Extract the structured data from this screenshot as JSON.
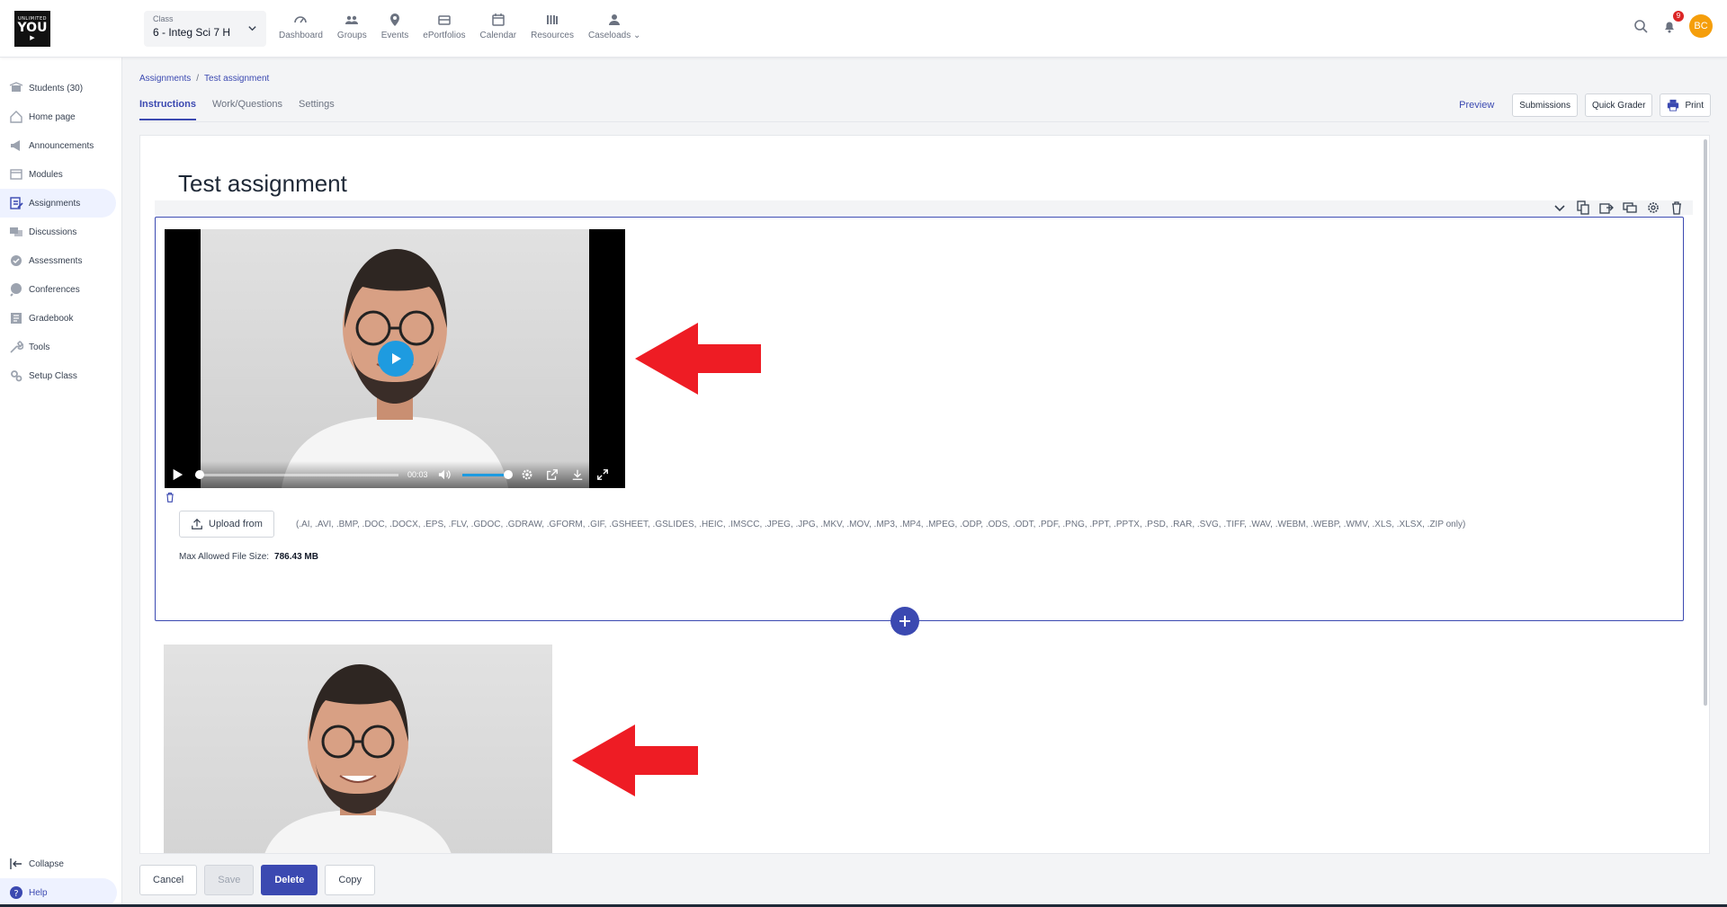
{
  "app": {
    "logo_text": [
      "UNLIMITED",
      "YOU",
      "▶"
    ]
  },
  "topbar": {
    "class_label": "Class",
    "class_value": "6 - Integ Sci 7 H",
    "nav": [
      {
        "label": "Dashboard",
        "icon": "gauge-icon"
      },
      {
        "label": "Groups",
        "icon": "users-icon"
      },
      {
        "label": "Events",
        "icon": "map-pin-icon"
      },
      {
        "label": "ePortfolios",
        "icon": "portfolio-icon"
      },
      {
        "label": "Calendar",
        "icon": "calendar-icon"
      },
      {
        "label": "Resources",
        "icon": "library-icon"
      },
      {
        "label": "Caseloads",
        "icon": "person-icon"
      }
    ],
    "notifications_count": "9",
    "avatar_initials": "BC"
  },
  "sidebar": {
    "items": [
      {
        "label": "Students (30)"
      },
      {
        "label": "Home page"
      },
      {
        "label": "Announcements"
      },
      {
        "label": "Modules"
      },
      {
        "label": "Assignments"
      },
      {
        "label": "Discussions"
      },
      {
        "label": "Assessments"
      },
      {
        "label": "Conferences"
      },
      {
        "label": "Gradebook"
      },
      {
        "label": "Tools"
      },
      {
        "label": "Setup Class"
      }
    ],
    "collapse_label": "Collapse",
    "help_label": "Help"
  },
  "breadcrumb": {
    "root": "Assignments",
    "separator": "/",
    "current": "Test assignment"
  },
  "tabs": [
    "Instructions",
    "Work/Questions",
    "Settings"
  ],
  "actions": {
    "preview": "Preview",
    "submissions": "Submissions",
    "quick_grader": "Quick Grader",
    "print": "Print"
  },
  "document": {
    "title": "Test assignment",
    "video": {
      "time": "00:03",
      "progress_fraction": 0.0,
      "volume_fraction": 1.0
    },
    "upload_label": "Upload from",
    "allowed_types": "(.AI, .AVI, .BMP, .DOC, .DOCX, .EPS, .FLV, .GDOC, .GDRAW, .GFORM, .GIF, .GSHEET, .GSLIDES, .HEIC, .IMSCC, .JPEG, .JPG, .MKV, .MOV, .MP3, .MP4, .MPEG, .ODP, .ODS, .ODT, .PDF, .PNG, .PPT, .PPTX, .PSD, .RAR, .SVG, .TIFF, .WAV, .WEBM, .WEBP, .WMV, .XLS, .XLSX, .ZIP only)",
    "max_size_label": "Max Allowed File Size:",
    "max_size_value": "786.43 MB"
  },
  "footer": {
    "cancel": "Cancel",
    "save": "Save",
    "delete": "Delete",
    "copy": "Copy"
  },
  "colors": {
    "accent": "#3b49b1",
    "arrow": "#ee1c24",
    "video_blue": "#1e9be0"
  }
}
